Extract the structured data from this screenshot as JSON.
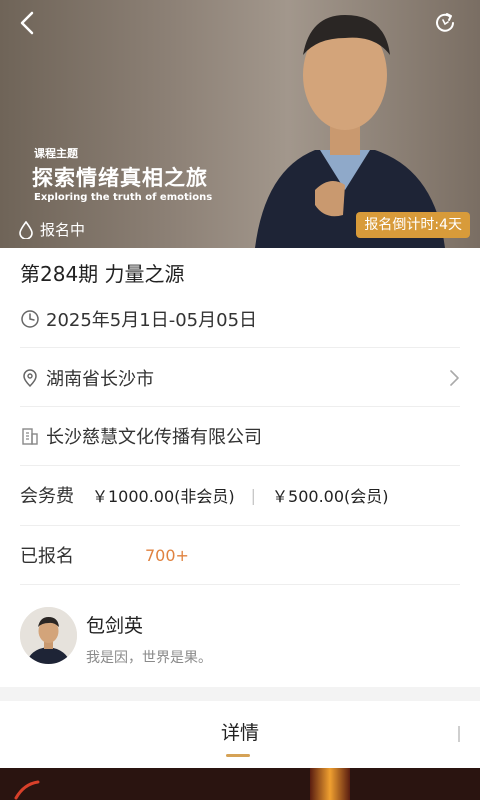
{
  "hero": {
    "topic_label": "课程主题",
    "topic_title": "探索情绪真相之旅",
    "topic_subtitle": "Exploring the truth of emotions",
    "status": "报名中",
    "countdown": "报名倒计时:4天"
  },
  "course": {
    "title": "第284期 力量之源",
    "date": "2025年5月1日-05月05日",
    "location": "湖南省长沙市",
    "organizer": "长沙慈慧文化传播有限公司"
  },
  "fee": {
    "label": "会务费",
    "non_member": "￥1000.00(非会员)",
    "separator": "|",
    "member": "￥500.00(会员)"
  },
  "enrolled": {
    "label": "已报名",
    "count": "700+"
  },
  "author": {
    "name": "包剑英",
    "motto": "我是因，世界是果。"
  },
  "tabs": {
    "details": "详情"
  },
  "colors": {
    "accent": "#d89b3a",
    "count": "#e0823f",
    "tab_underline": "#d5a256"
  },
  "icons": [
    "back-arrow-icon",
    "refresh-icon",
    "drop-icon",
    "clock-icon",
    "location-pin-icon",
    "building-icon",
    "chevron-right-icon"
  ]
}
